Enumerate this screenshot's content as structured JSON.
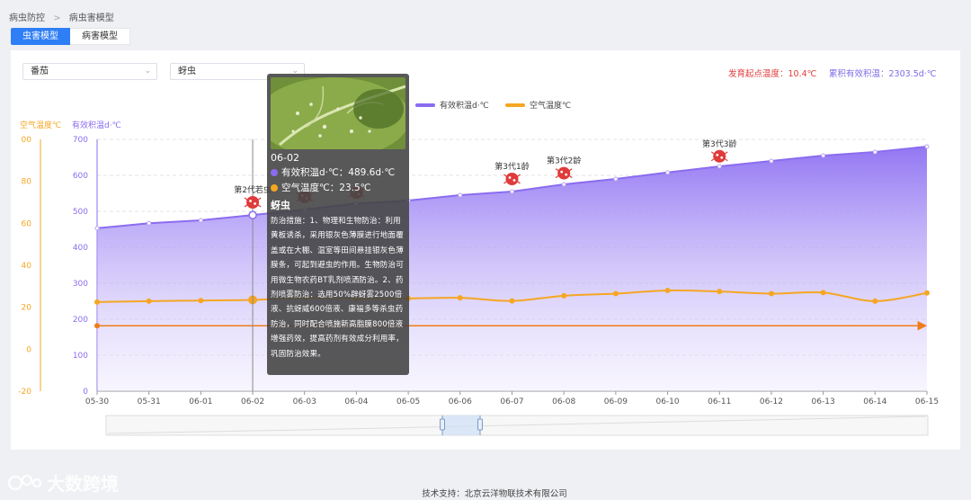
{
  "breadcrumb": {
    "parent": "病虫防控",
    "separator": ">",
    "current": "病虫害模型"
  },
  "tabs": [
    {
      "label": "虫害模型",
      "active": true
    },
    {
      "label": "病害模型",
      "active": false
    }
  ],
  "filters": {
    "crop": "番茄",
    "pest": "蚜虫"
  },
  "info": {
    "start_temp": "发育起点温度：10.4℃",
    "accum_temp": "累积有效积温：2303.5d·℃"
  },
  "colors": {
    "accent": "#2e7ef6",
    "accum": "#8b6cf0",
    "air": "#f5a623",
    "arrow": "#f07c1a",
    "red": "#e03a3a"
  },
  "chart_data": {
    "type": "line",
    "title": "",
    "legend": [
      "有效积温d·℃",
      "空气温度℃"
    ],
    "legend_position": "top-center",
    "left_axis_labels": [
      "空气温度℃",
      "有效积温d·℃"
    ],
    "x": [
      "05-30",
      "05-31",
      "06-01",
      "06-02",
      "06-03",
      "06-04",
      "06-05",
      "06-06",
      "06-07",
      "06-08",
      "06-09",
      "06-10",
      "06-11",
      "06-12",
      "06-13",
      "06-14",
      "06-15"
    ],
    "y_accum_ticks": [
      0,
      100,
      200,
      300,
      400,
      500,
      600,
      700
    ],
    "y_temp_ticks": [
      -20,
      0,
      20,
      40,
      60,
      80,
      100
    ],
    "y_temp_tick_labels": [
      "-20",
      "0",
      "20",
      "40",
      "60",
      "80",
      "00"
    ],
    "y_accum_lim": [
      0,
      700
    ],
    "y_temp_lim": [
      -20,
      100
    ],
    "grid": "dashed horizontal",
    "series": [
      {
        "name": "有效积温d·℃",
        "axis": "accum",
        "area": true,
        "values": [
          453,
          467,
          475,
          489.6,
          505,
          522,
          530,
          545,
          555,
          575,
          590,
          608,
          625,
          640,
          655,
          665,
          680
        ]
      },
      {
        "name": "空气温度℃",
        "axis": "temp",
        "values": [
          22.5,
          22.9,
          23.2,
          23.5,
          24.5,
          24.0,
          24.2,
          24.5,
          23.0,
          25.5,
          26.5,
          28.0,
          27.5,
          26.5,
          27.0,
          22.9,
          26.8
        ]
      }
    ],
    "arrow_value": 182,
    "markers": [
      {
        "label": "第2代若虫",
        "x": "06-02",
        "y": 525
      },
      {
        "label": "",
        "x": "06-03",
        "y": 540
      },
      {
        "label": "",
        "x": "06-04",
        "y": 552
      },
      {
        "label": "第3代1龄",
        "x": "06-07",
        "y": 590
      },
      {
        "label": "第3代2龄",
        "x": "06-08",
        "y": 606
      },
      {
        "label": "第3代3龄",
        "x": "06-11",
        "y": 653
      }
    ],
    "hover_x": "06-02"
  },
  "tooltip": {
    "date": "06-02",
    "accum_label": "有效积温d·℃：489.6d·℃",
    "air_label": "空气温度℃：23.5℃",
    "pest": "蚜虫",
    "measure": "防治措施：1、物理和生物防治：利用黄板诱杀，采用银灰色薄膜进行地面覆盖或在大棚、温室等田间悬挂银灰色薄膜条，可起到避虫的作用。生物防治可用微生物农药BT乳剂喷洒防治。2、药剂喷雾防治：选用50%辟蚜雾2500倍液、抗蚜威600倍液、康福多等杀虫药防治，同时配合喷施新高脂膜800倍液增强药效，提高药剂有效成分利用率，巩固防治效果。"
  },
  "footer": "技术支持：北京云洋物联技术有限公司",
  "watermark": "大数跨境"
}
